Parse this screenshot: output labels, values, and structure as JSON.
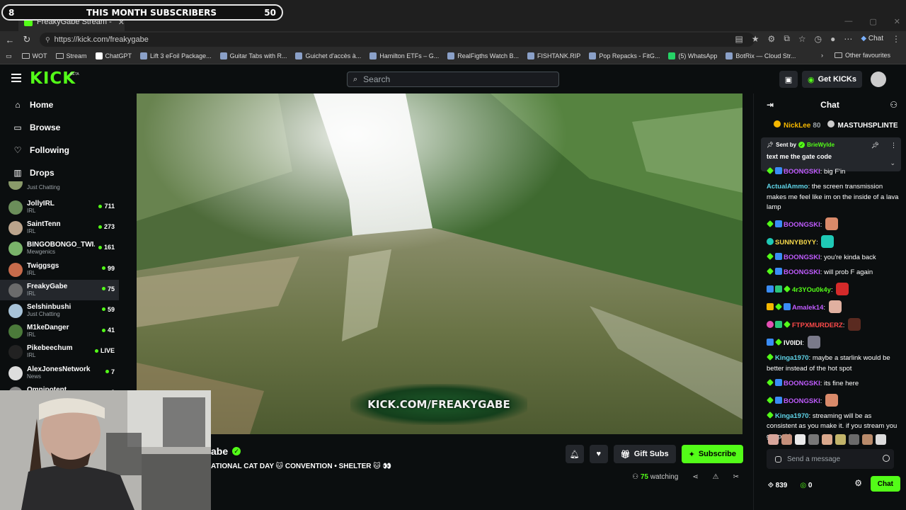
{
  "browser": {
    "tab_title": "FreakyGabe Stream - Watch Li",
    "url": "https://kick.com/freakygabe",
    "chat_button": "Chat",
    "bookmarks": [
      {
        "label": "WOT",
        "icon": "folder"
      },
      {
        "label": "Stream",
        "icon": "folder"
      },
      {
        "label": "ChatGPT",
        "icon": "chatgpt"
      },
      {
        "label": "Lift 3 eFoil Package...",
        "icon": "site"
      },
      {
        "label": "Guitar Tabs with R...",
        "icon": "site"
      },
      {
        "label": "Guichet d'accès à...",
        "icon": "site"
      },
      {
        "label": "Hamilton ETFs – G...",
        "icon": "site"
      },
      {
        "label": "RealFigths Watch B...",
        "icon": "site"
      },
      {
        "label": "FISHTANK.RIP",
        "icon": "site"
      },
      {
        "label": "Pop Repacks - FitG...",
        "icon": "site"
      },
      {
        "label": "(5) WhatsApp",
        "icon": "whatsapp"
      },
      {
        "label": "BotRix — Cloud Str...",
        "icon": "site"
      }
    ],
    "other_favourites": "Other favourites"
  },
  "overlay": {
    "left_number": "8",
    "title": "THIS MONTH SUBSCRIBERS",
    "right_number": "50"
  },
  "header": {
    "logo": "KICK",
    "beta": "BETA",
    "search_placeholder": "Search",
    "get_kicks": "Get KICKs"
  },
  "sidebar": {
    "nav": [
      {
        "label": "Home",
        "icon": "home-icon"
      },
      {
        "label": "Browse",
        "icon": "browse-icon"
      },
      {
        "label": "Following",
        "icon": "heart-icon"
      },
      {
        "label": "Drops",
        "icon": "drops-icon"
      }
    ],
    "partial_top_category": "Just Chatting",
    "channels": [
      {
        "name": "JollyIRL",
        "category": "IRL",
        "viewers": "711",
        "color": "#6b8e5a"
      },
      {
        "name": "SaintTenn",
        "category": "IRL",
        "viewers": "273",
        "color": "#bba48c"
      },
      {
        "name": "BINGOBONGO_TWI...",
        "category": "Mewgenics",
        "viewers": "161",
        "color": "#7ab36a"
      },
      {
        "name": "Twiggsgs",
        "category": "IRL",
        "viewers": "99",
        "color": "#c76b4b"
      },
      {
        "name": "FreakyGabe",
        "category": "IRL",
        "viewers": "75",
        "color": "#6b6b6b",
        "active": true
      },
      {
        "name": "Selshinbushi",
        "category": "Just Chatting",
        "viewers": "59",
        "color": "#a8c3d8"
      },
      {
        "name": "M1keDanger",
        "category": "IRL",
        "viewers": "41",
        "color": "#4b7a3a"
      },
      {
        "name": "Pikebeechum",
        "category": "IRL",
        "viewers": "LIVE",
        "color": "#222222"
      },
      {
        "name": "AlexJonesNetwork",
        "category": "News",
        "viewers": "7",
        "color": "#dddddd"
      },
      {
        "name": "Omnipotent",
        "category": "",
        "viewers": "3",
        "color": "#888888"
      }
    ]
  },
  "video": {
    "watermark": "KICK.COM/FREAKYGABE"
  },
  "stream": {
    "streamer_name_partial": "abe",
    "title_partial": "ATIONAL CAT DAY 🐱 CONVENTION • SHELTER 🐱 👀",
    "gift_subs": "Gift Subs",
    "subscribe": "Subscribe",
    "watching_count": "75",
    "watching_label": "watching"
  },
  "chat": {
    "title": "Chat",
    "gifters": [
      {
        "name": "NickLee",
        "amount": "80",
        "coin": "gold"
      },
      {
        "name": "MASTUHSPLINTE",
        "amount": "",
        "coin": "silver"
      }
    ],
    "pinned": {
      "sent_by": "Sent by",
      "user": "BrieWylde",
      "message": "text me the gate code"
    },
    "messages": [
      {
        "badges": [
          "diamond",
          "blue"
        ],
        "user": "BOONGSKI",
        "color": "#c05cff",
        "text": "big F'in",
        "emote": ""
      },
      {
        "badges": [],
        "user": "ActualAmmo",
        "color": "#5fd4e8",
        "text": "the screen transmission makes me feel like im on the inside of a lava lamp",
        "emote": ""
      },
      {
        "badges": [
          "diamond",
          "blue"
        ],
        "user": "BOONGSKI",
        "color": "#c05cff",
        "text": "",
        "emote": "#d98a6a"
      },
      {
        "badges": [
          "teal"
        ],
        "user": "SUNNYB0YY",
        "color": "#f5d74a",
        "text": "",
        "emote": "#1fc9b6"
      },
      {
        "badges": [
          "diamond",
          "blue"
        ],
        "user": "BOONGSKI",
        "color": "#c05cff",
        "text": "you're kinda back",
        "emote": ""
      },
      {
        "badges": [
          "diamond",
          "blue"
        ],
        "user": "BOONGSKI",
        "color": "#c05cff",
        "text": "will prob F again",
        "emote": ""
      },
      {
        "badges": [
          "blue",
          "green2",
          "diamond"
        ],
        "user": "4r3YOu0k4y",
        "color": "#53fc18",
        "text": "",
        "emote": "#d42a2a"
      },
      {
        "badges": [
          "gold",
          "diamond",
          "blue"
        ],
        "user": "Amalek14",
        "color": "#c05cff",
        "text": "",
        "emote": "#e0b0a0"
      },
      {
        "badges": [
          "pink",
          "green2",
          "diamond"
        ],
        "user": "FTPXMURDERZ",
        "color": "#ff4a4a",
        "text": "",
        "emote": "#5a2a20"
      },
      {
        "badges": [
          "blue",
          "diamond"
        ],
        "user": "IV0IDI",
        "color": "#ffffff",
        "text": "",
        "emote": "#7a7a8a"
      },
      {
        "badges": [
          "diamond"
        ],
        "user": "Kinga1970",
        "color": "#5fd4e8",
        "text": "maybe a starlink would be better instead of the hot spot",
        "emote": ""
      },
      {
        "badges": [
          "diamond",
          "blue"
        ],
        "user": "BOONGSKI",
        "color": "#c05cff",
        "text": "its fine here",
        "emote": ""
      },
      {
        "badges": [
          "diamond",
          "blue"
        ],
        "user": "BOONGSKI",
        "color": "#c05cff",
        "text": "",
        "emote": "#d98a6a"
      },
      {
        "badges": [
          "diamond"
        ],
        "user": "Kinga1970",
        "color": "#5fd4e8",
        "text": "streaming will be as consistent as you make it. if you stream you get paid",
        "emote": ""
      }
    ],
    "input_placeholder": "Send a message",
    "kicks_count": "839",
    "points_count": "0",
    "send_label": "Chat"
  }
}
